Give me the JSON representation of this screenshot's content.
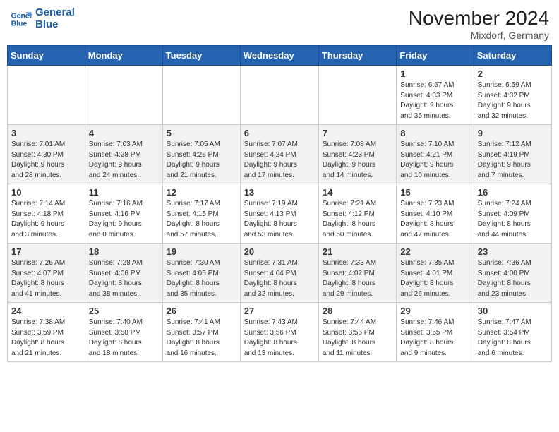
{
  "header": {
    "logo_line1": "General",
    "logo_line2": "Blue",
    "month_title": "November 2024",
    "location": "Mixdorf, Germany"
  },
  "days_of_week": [
    "Sunday",
    "Monday",
    "Tuesday",
    "Wednesday",
    "Thursday",
    "Friday",
    "Saturday"
  ],
  "weeks": [
    [
      {
        "day": "",
        "info": ""
      },
      {
        "day": "",
        "info": ""
      },
      {
        "day": "",
        "info": ""
      },
      {
        "day": "",
        "info": ""
      },
      {
        "day": "",
        "info": ""
      },
      {
        "day": "1",
        "info": "Sunrise: 6:57 AM\nSunset: 4:33 PM\nDaylight: 9 hours\nand 35 minutes."
      },
      {
        "day": "2",
        "info": "Sunrise: 6:59 AM\nSunset: 4:32 PM\nDaylight: 9 hours\nand 32 minutes."
      }
    ],
    [
      {
        "day": "3",
        "info": "Sunrise: 7:01 AM\nSunset: 4:30 PM\nDaylight: 9 hours\nand 28 minutes."
      },
      {
        "day": "4",
        "info": "Sunrise: 7:03 AM\nSunset: 4:28 PM\nDaylight: 9 hours\nand 24 minutes."
      },
      {
        "day": "5",
        "info": "Sunrise: 7:05 AM\nSunset: 4:26 PM\nDaylight: 9 hours\nand 21 minutes."
      },
      {
        "day": "6",
        "info": "Sunrise: 7:07 AM\nSunset: 4:24 PM\nDaylight: 9 hours\nand 17 minutes."
      },
      {
        "day": "7",
        "info": "Sunrise: 7:08 AM\nSunset: 4:23 PM\nDaylight: 9 hours\nand 14 minutes."
      },
      {
        "day": "8",
        "info": "Sunrise: 7:10 AM\nSunset: 4:21 PM\nDaylight: 9 hours\nand 10 minutes."
      },
      {
        "day": "9",
        "info": "Sunrise: 7:12 AM\nSunset: 4:19 PM\nDaylight: 9 hours\nand 7 minutes."
      }
    ],
    [
      {
        "day": "10",
        "info": "Sunrise: 7:14 AM\nSunset: 4:18 PM\nDaylight: 9 hours\nand 3 minutes."
      },
      {
        "day": "11",
        "info": "Sunrise: 7:16 AM\nSunset: 4:16 PM\nDaylight: 9 hours\nand 0 minutes."
      },
      {
        "day": "12",
        "info": "Sunrise: 7:17 AM\nSunset: 4:15 PM\nDaylight: 8 hours\nand 57 minutes."
      },
      {
        "day": "13",
        "info": "Sunrise: 7:19 AM\nSunset: 4:13 PM\nDaylight: 8 hours\nand 53 minutes."
      },
      {
        "day": "14",
        "info": "Sunrise: 7:21 AM\nSunset: 4:12 PM\nDaylight: 8 hours\nand 50 minutes."
      },
      {
        "day": "15",
        "info": "Sunrise: 7:23 AM\nSunset: 4:10 PM\nDaylight: 8 hours\nand 47 minutes."
      },
      {
        "day": "16",
        "info": "Sunrise: 7:24 AM\nSunset: 4:09 PM\nDaylight: 8 hours\nand 44 minutes."
      }
    ],
    [
      {
        "day": "17",
        "info": "Sunrise: 7:26 AM\nSunset: 4:07 PM\nDaylight: 8 hours\nand 41 minutes."
      },
      {
        "day": "18",
        "info": "Sunrise: 7:28 AM\nSunset: 4:06 PM\nDaylight: 8 hours\nand 38 minutes."
      },
      {
        "day": "19",
        "info": "Sunrise: 7:30 AM\nSunset: 4:05 PM\nDaylight: 8 hours\nand 35 minutes."
      },
      {
        "day": "20",
        "info": "Sunrise: 7:31 AM\nSunset: 4:04 PM\nDaylight: 8 hours\nand 32 minutes."
      },
      {
        "day": "21",
        "info": "Sunrise: 7:33 AM\nSunset: 4:02 PM\nDaylight: 8 hours\nand 29 minutes."
      },
      {
        "day": "22",
        "info": "Sunrise: 7:35 AM\nSunset: 4:01 PM\nDaylight: 8 hours\nand 26 minutes."
      },
      {
        "day": "23",
        "info": "Sunrise: 7:36 AM\nSunset: 4:00 PM\nDaylight: 8 hours\nand 23 minutes."
      }
    ],
    [
      {
        "day": "24",
        "info": "Sunrise: 7:38 AM\nSunset: 3:59 PM\nDaylight: 8 hours\nand 21 minutes."
      },
      {
        "day": "25",
        "info": "Sunrise: 7:40 AM\nSunset: 3:58 PM\nDaylight: 8 hours\nand 18 minutes."
      },
      {
        "day": "26",
        "info": "Sunrise: 7:41 AM\nSunset: 3:57 PM\nDaylight: 8 hours\nand 16 minutes."
      },
      {
        "day": "27",
        "info": "Sunrise: 7:43 AM\nSunset: 3:56 PM\nDaylight: 8 hours\nand 13 minutes."
      },
      {
        "day": "28",
        "info": "Sunrise: 7:44 AM\nSunset: 3:56 PM\nDaylight: 8 hours\nand 11 minutes."
      },
      {
        "day": "29",
        "info": "Sunrise: 7:46 AM\nSunset: 3:55 PM\nDaylight: 8 hours\nand 9 minutes."
      },
      {
        "day": "30",
        "info": "Sunrise: 7:47 AM\nSunset: 3:54 PM\nDaylight: 8 hours\nand 6 minutes."
      }
    ]
  ]
}
